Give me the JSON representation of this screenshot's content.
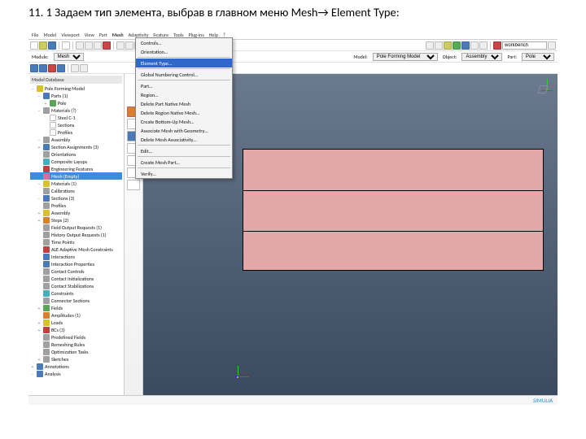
{
  "caption": {
    "num": "11. 1 ",
    "text": "Задаем тип элемента, выбрав в главном меню Mesh",
    "arrow": "→",
    "tail": " Element Type:"
  },
  "menubar": [
    "File",
    "Model",
    "Viewport",
    "View",
    "Part",
    "Mesh",
    "Adaptivity",
    "Feature",
    "Tools",
    "Plug-ins",
    "Help",
    "?"
  ],
  "context_row": {
    "module_lbl": "Module:",
    "module": "Mesh",
    "model_lbl": "Model:",
    "model": "Pole Forming Model",
    "object_lbl": "Object:",
    "object": "Assembly",
    "part_lbl": "Part:",
    "part": "Pole"
  },
  "toolbar_search": "workbench",
  "tree_header": "Model Database",
  "tree": [
    {
      "lvl": 1,
      "tw": "−",
      "ic": "yl",
      "t": "Pole Forming Model"
    },
    {
      "lvl": 2,
      "tw": "−",
      "ic": "bl",
      "t": "Parts (1)"
    },
    {
      "lvl": 3,
      "tw": "+",
      "ic": "gn",
      "t": "Pole"
    },
    {
      "lvl": 2,
      "tw": "−",
      "ic": "gy",
      "t": "Materials (?)"
    },
    {
      "lvl": 3,
      "tw": "",
      "ic": "wh",
      "t": "Steel C-1"
    },
    {
      "lvl": 3,
      "tw": "",
      "ic": "wh",
      "t": "Sections"
    },
    {
      "lvl": 3,
      "tw": "",
      "ic": "wh",
      "t": "Profiles"
    },
    {
      "lvl": 2,
      "tw": "−",
      "ic": "gy",
      "t": "Assembly"
    },
    {
      "lvl": 2,
      "tw": "+",
      "ic": "bl",
      "t": "Section Assignments (3)"
    },
    {
      "lvl": 2,
      "tw": "",
      "ic": "gy",
      "t": "Orientations"
    },
    {
      "lvl": 2,
      "tw": "",
      "ic": "cy",
      "t": "Composite Layups"
    },
    {
      "lvl": 2,
      "tw": "",
      "ic": "rd",
      "t": "Engineering Features",
      "sel": false
    },
    {
      "lvl": 2,
      "tw": "",
      "ic": "pk",
      "t": "Mesh (Empty)",
      "sel": true
    },
    {
      "lvl": 2,
      "tw": "−",
      "ic": "yl",
      "t": "Materials (1)"
    },
    {
      "lvl": 2,
      "tw": "",
      "ic": "gy",
      "t": "Calibrations"
    },
    {
      "lvl": 2,
      "tw": "−",
      "ic": "bl",
      "t": "Sections (3)"
    },
    {
      "lvl": 2,
      "tw": "",
      "ic": "gy",
      "t": "Profiles"
    },
    {
      "lvl": 2,
      "tw": "+",
      "ic": "yl",
      "t": "Assembly"
    },
    {
      "lvl": 2,
      "tw": "+",
      "ic": "or",
      "t": "Steps (2)"
    },
    {
      "lvl": 2,
      "tw": "",
      "ic": "gy",
      "t": "Field Output Requests (1)"
    },
    {
      "lvl": 2,
      "tw": "",
      "ic": "gy",
      "t": "History Output Requests (1)"
    },
    {
      "lvl": 2,
      "tw": "",
      "ic": "gy",
      "t": "Time Points"
    },
    {
      "lvl": 2,
      "tw": "",
      "ic": "rd",
      "t": "ALE Adaptive Mesh Constraints"
    },
    {
      "lvl": 2,
      "tw": "",
      "ic": "bl",
      "t": "Interactions"
    },
    {
      "lvl": 2,
      "tw": "",
      "ic": "bl",
      "t": "Interaction Properties"
    },
    {
      "lvl": 2,
      "tw": "",
      "ic": "gy",
      "t": "Contact Controls"
    },
    {
      "lvl": 2,
      "tw": "",
      "ic": "gy",
      "t": "Contact Initializations"
    },
    {
      "lvl": 2,
      "tw": "",
      "ic": "gy",
      "t": "Contact Stabilizations"
    },
    {
      "lvl": 2,
      "tw": "",
      "ic": "cy",
      "t": "Constraints"
    },
    {
      "lvl": 2,
      "tw": "",
      "ic": "gy",
      "t": "Connector Sections"
    },
    {
      "lvl": 2,
      "tw": "+",
      "ic": "gn",
      "t": "Fields"
    },
    {
      "lvl": 2,
      "tw": "",
      "ic": "or",
      "t": "Amplitudes (1)"
    },
    {
      "lvl": 2,
      "tw": "+",
      "ic": "yl",
      "t": "Loads"
    },
    {
      "lvl": 2,
      "tw": "+",
      "ic": "rd",
      "t": "BCs (3)"
    },
    {
      "lvl": 2,
      "tw": "",
      "ic": "gy",
      "t": "Predefined Fields"
    },
    {
      "lvl": 2,
      "tw": "",
      "ic": "gy",
      "t": "Remeshing Rules"
    },
    {
      "lvl": 2,
      "tw": "",
      "ic": "gy",
      "t": "Optimization Tasks"
    },
    {
      "lvl": 2,
      "tw": "+",
      "ic": "gy",
      "t": "Sketches"
    },
    {
      "lvl": 1,
      "tw": "+",
      "ic": "bl",
      "t": "Annotations"
    },
    {
      "lvl": 1,
      "tw": "−",
      "ic": "bl",
      "t": "Analysis"
    }
  ],
  "menu": {
    "items": [
      "Controls…",
      "Orientation…",
      "|",
      "Element Type…",
      "|",
      "Global Numbering Control…",
      "|",
      "Part…",
      "Region…",
      "Delete Part Native Mesh",
      "Delete Region Native Mesh…",
      "Create Bottom-Up Mesh…",
      "Associate Mesh with Geometry…",
      "Delete Mesh Associativity…",
      "|",
      "Edit…",
      "|",
      "Create Mesh Part…",
      "|",
      "Verify…"
    ],
    "highlight": "Element Type…"
  },
  "brand": "SIMULIA"
}
